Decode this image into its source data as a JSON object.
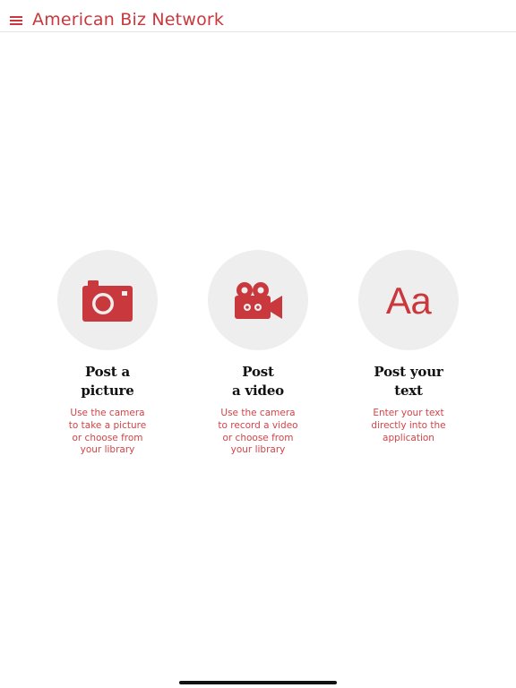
{
  "header": {
    "title": "American Biz Network",
    "menu_icon": "hamburger-menu-icon"
  },
  "colors": {
    "accent": "#c8383d",
    "circle_bg": "#efeeee",
    "title_text": "#111111"
  },
  "options": [
    {
      "icon": "camera-icon",
      "title_lines": [
        "Post a",
        "picture"
      ],
      "desc_lines": [
        "Use the camera",
        "to take a picture",
        "or choose from",
        "your library"
      ]
    },
    {
      "icon": "video-camera-icon",
      "title_lines": [
        "Post",
        "a video"
      ],
      "desc_lines": [
        "Use the camera",
        "to record a video",
        "or choose from",
        "your library"
      ]
    },
    {
      "icon": "text-icon",
      "glyph": "Aa",
      "title_lines": [
        "Post your",
        "text"
      ],
      "desc_lines": [
        "Enter your text",
        "directly into the",
        "application"
      ]
    }
  ]
}
